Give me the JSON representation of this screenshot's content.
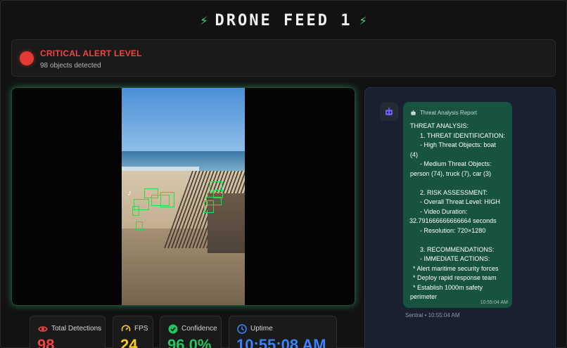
{
  "header": {
    "title": "DRONE FEED 1",
    "bolt_left": "⚡",
    "bolt_right": "⚡"
  },
  "alert": {
    "title": "CRITICAL ALERT LEVEL",
    "subtitle": "98 objects detected",
    "color": "#ef4444"
  },
  "video": {
    "watermark": "♪"
  },
  "stats": [
    {
      "label": "Total Detections",
      "value": "98",
      "icon": "eye-icon",
      "color": "#ef4444"
    },
    {
      "label": "FPS",
      "value": "24",
      "icon": "speedometer-icon",
      "color": "#facc15"
    },
    {
      "label": "Confidence",
      "value": "96.0%",
      "icon": "check-badge-icon",
      "color": "#22c55e"
    },
    {
      "label": "Uptime",
      "value": "10:55:08 AM",
      "icon": "clock-icon",
      "color": "#3b82f6"
    }
  ],
  "chat": {
    "header_label": "Threat Analysis Report",
    "lines": [
      "THREAT ANALYSIS:",
      "1. THREAT IDENTIFICATION:",
      "- High Threat Objects: boat",
      "(4)",
      "- Medium Threat Objects:",
      "person (74), truck (7), car (3)",
      "",
      "2. RISK ASSESSMENT:",
      "- Overall Threat Level: HIGH",
      "- Video Duration:",
      "32.791666666666664 seconds",
      "- Resolution: 720×1280",
      "",
      "3. RECOMMENDATIONS:",
      "- IMMEDIATE ACTIONS:",
      "* Alert maritime security forces",
      "* Deploy rapid response team",
      "* Establish 1000m safety",
      "perimeter"
    ],
    "time": "10:55:04 AM",
    "meta": "Sentral • 10:55:04 AM"
  }
}
